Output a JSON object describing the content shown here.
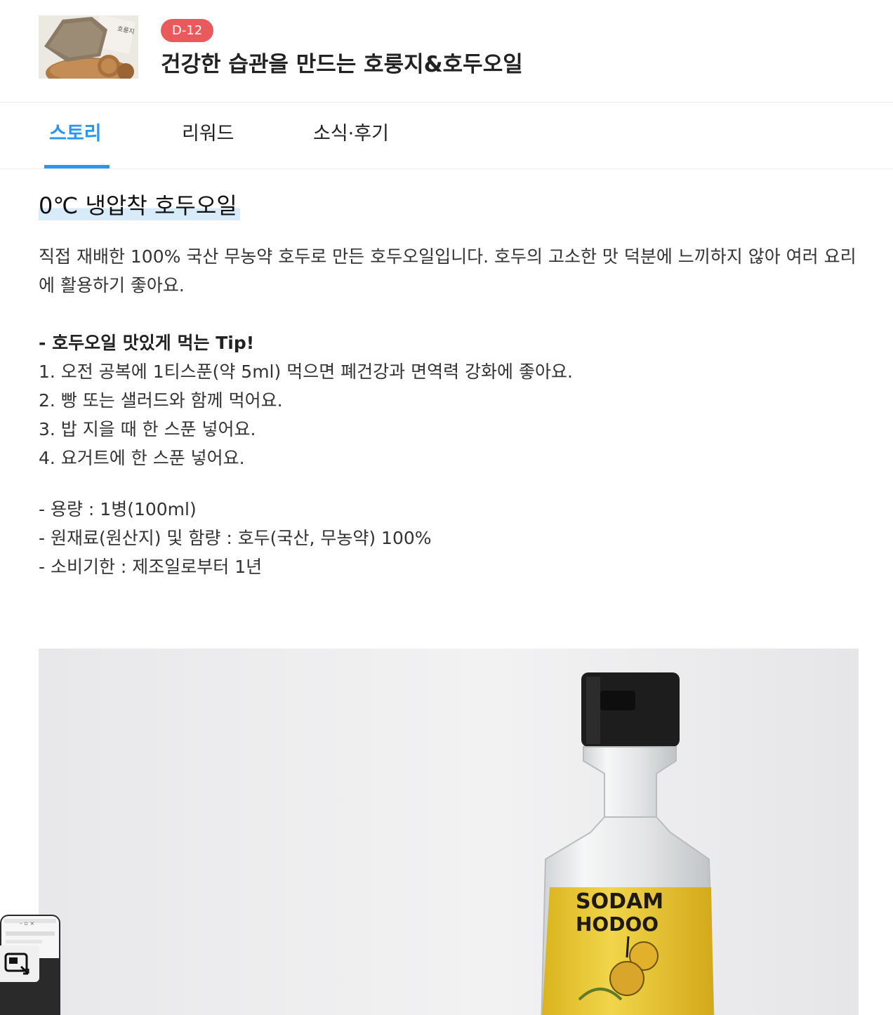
{
  "header": {
    "badge": "D-12",
    "title": "건강한 습관을 만드는 호룽지&호두오일",
    "thumb_label": "호룽지"
  },
  "tabs": [
    {
      "label": "스토리",
      "active": true
    },
    {
      "label": "리워드",
      "active": false
    },
    {
      "label": "소식·후기",
      "active": false
    }
  ],
  "story": {
    "heading": "0℃ 냉압착 호두오일",
    "intro": "직접 재배한 100% 국산 무농약 호두로 만든 호두오일입니다. 호두의 고소한 맛 덕분에 느끼하지 않아 여러 요리에 활용하기 좋아요.",
    "tip_title": "- 호두오일 맛있게 먹는 Tip!",
    "tips": [
      "1. 오전 공복에 1티스푼(약 5ml) 먹으면 폐건강과 면역력 강화에 좋아요.",
      "2. 빵 또는 샐러드와 함께 먹어요.",
      "3. 밥 지을 때 한 스푼 넣어요.",
      "4. 요거트에 한 스푼 넣어요."
    ],
    "specs": [
      "- 용량 : 1병(100ml)",
      "- 원재료(원산지) 및 함량 : 호두(국산, 무농약) 100%",
      "- 소비기한 : 제조일로부터 1년"
    ]
  },
  "product_image": {
    "label_line1": "SODAM",
    "label_line2": "HODOO"
  },
  "colors": {
    "accent": "#2a96f0",
    "badge": "#e95a5c",
    "highlight": "#d7ebf9"
  }
}
